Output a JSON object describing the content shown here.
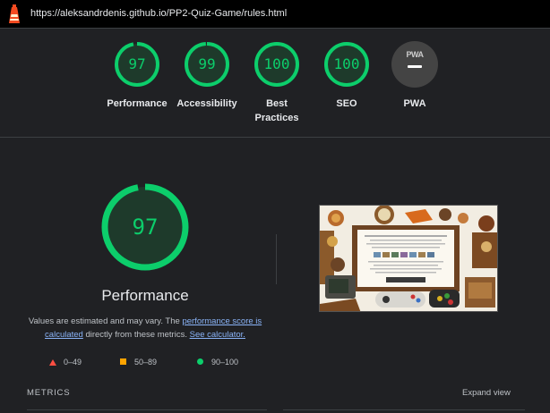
{
  "browser": {
    "url": "https://aleksandrdenis.github.io/PP2-Quiz-Game/rules.html",
    "logo_icon": "lighthouse-icon"
  },
  "categories": [
    {
      "label": "Performance",
      "score": "97",
      "fraction": 0.97,
      "status": "pass"
    },
    {
      "label": "Accessibility",
      "score": "99",
      "fraction": 0.99,
      "status": "pass"
    },
    {
      "label": "Best\nPractices",
      "score": "100",
      "fraction": 1.0,
      "status": "pass"
    },
    {
      "label": "SEO",
      "score": "100",
      "fraction": 1.0,
      "status": "pass"
    },
    {
      "label": "PWA",
      "badge_text": "PWA",
      "status": "na"
    }
  ],
  "performance": {
    "score": "97",
    "fraction": 0.97,
    "title": "Performance",
    "description_pre": "Values are estimated and may vary. The ",
    "link1": "performance score is calculated",
    "description_mid": " directly from these metrics. ",
    "link2": "See calculator."
  },
  "legend": [
    {
      "range": "0–49",
      "shape": "triangle",
      "color": "#ff4e42"
    },
    {
      "range": "50–89",
      "shape": "square",
      "color": "#ffa400"
    },
    {
      "range": "90–100",
      "shape": "circle",
      "color": "#0cce6b"
    }
  ],
  "metrics": {
    "heading": "METRICS",
    "expand_label": "Expand view"
  },
  "colors": {
    "pass": "#0cce6b",
    "average": "#ffa400",
    "fail": "#ff4e42",
    "link": "#8ab4f8",
    "background": "#202124"
  }
}
